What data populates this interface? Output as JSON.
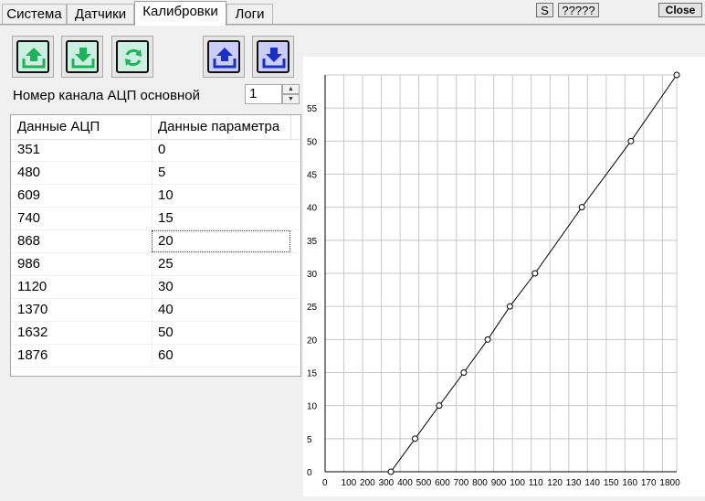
{
  "tabs": [
    "Система",
    "Датчики",
    "Калибровки",
    "Логи"
  ],
  "active_tab": "Калибровки",
  "top_buttons": {
    "s_label": "S",
    "q_label": "?????",
    "close_label": "Close"
  },
  "toolbar": {
    "btn1_icon": "upload-icon",
    "btn2_icon": "download-icon",
    "btn3_icon": "refresh-icon",
    "btn4_icon": "upload-icon",
    "btn5_icon": "download-icon",
    "green_color": "#1cb35b",
    "blue_color": "#1b2fc8"
  },
  "channel": {
    "label": "Номер канала АЦП основной",
    "value": "1"
  },
  "table": {
    "headers": [
      "Данные АЦП",
      "Данные параметра"
    ],
    "rows": [
      [
        "351",
        "0"
      ],
      [
        "480",
        "5"
      ],
      [
        "609",
        "10"
      ],
      [
        "740",
        "15"
      ],
      [
        "868",
        "20"
      ],
      [
        "986",
        "25"
      ],
      [
        "1120",
        "30"
      ],
      [
        "1370",
        "40"
      ],
      [
        "1632",
        "50"
      ],
      [
        "1876",
        "60"
      ]
    ],
    "selected_row": 4
  },
  "chart_data": {
    "type": "line",
    "x": [
      351,
      480,
      609,
      740,
      868,
      986,
      1120,
      1370,
      1632,
      1876
    ],
    "y": [
      0,
      5,
      10,
      15,
      20,
      25,
      30,
      40,
      50,
      60
    ],
    "xlim": [
      0,
      1876
    ],
    "ylim": [
      0,
      60
    ],
    "x_tick_labels": [
      "0",
      "100",
      "200",
      "300",
      "400",
      "500",
      "600",
      "700",
      "800",
      "900",
      "100",
      "110",
      "120",
      "130",
      "140",
      "150",
      "160",
      "170",
      "1800"
    ],
    "y_tick_labels": [
      "0",
      "5",
      "10",
      "15",
      "20",
      "25",
      "30",
      "35",
      "40",
      "45",
      "50",
      "55"
    ],
    "grid": true,
    "marker": "circle",
    "title": "",
    "xlabel": "",
    "ylabel": ""
  }
}
